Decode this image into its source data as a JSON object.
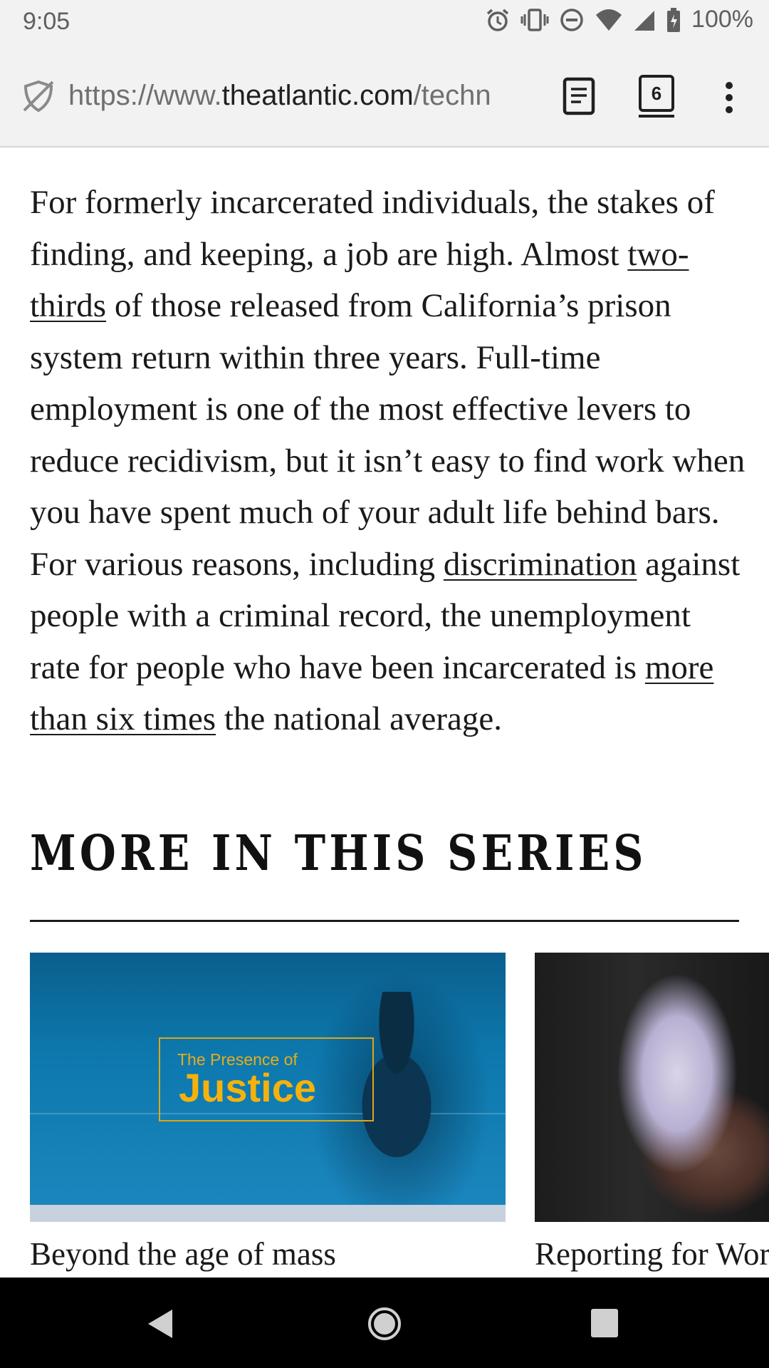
{
  "status_bar": {
    "time": "9:05",
    "battery": "100%",
    "icons": [
      "alarm-icon",
      "vibrate-icon",
      "do-not-disturb-icon",
      "wifi-icon",
      "cellular-icon",
      "battery-icon"
    ]
  },
  "browser": {
    "url_prefix": "https://www.",
    "url_domain": "theatlantic.com",
    "url_rest": "/techn",
    "tab_count": "6"
  },
  "article": {
    "p1": "For formerly incarcerated individuals, the stakes of finding, and keeping, a job are high. Almost ",
    "link1": "two-thirds",
    "p2": " of those released from California’s prison system return within three years. Full-time employment is one of the most effective levers to reduce recidivism, but it isn’t easy to find work when you have spent much of your adult life behind bars. For various reasons, including ",
    "link2": "discrimination",
    "p3": " against people with a criminal record, the unemployment rate for people who have been incarcerated is ",
    "link3": "more than six times",
    "p4": " the national average."
  },
  "series": {
    "heading": "MORE IN THIS SERIES",
    "cards": [
      {
        "overlay_top": "The Presence of",
        "overlay_main": "Justice",
        "title": "Beyond the age of mass"
      },
      {
        "title": "Reporting for Wor"
      }
    ]
  },
  "colors": {
    "justice_gold": "#f5b20c",
    "card_blue": "#0d78ad"
  }
}
